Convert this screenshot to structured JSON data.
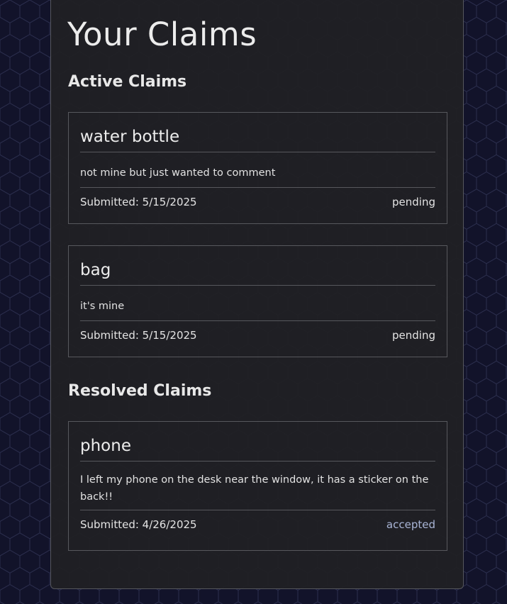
{
  "page": {
    "title": "Your Claims"
  },
  "sections": {
    "active": {
      "heading": "Active Claims",
      "claims": [
        {
          "item": "water bottle",
          "description": "not mine but just wanted to comment",
          "submitted": "Submitted: 5/15/2025",
          "status": "pending"
        },
        {
          "item": "bag",
          "description": "it's mine",
          "submitted": "Submitted: 5/15/2025",
          "status": "pending"
        }
      ]
    },
    "resolved": {
      "heading": "Resolved Claims",
      "claims": [
        {
          "item": "phone",
          "description": "I left my phone on the desk near the window, it has a sticker on the back!!",
          "submitted": "Submitted: 4/26/2025",
          "status": "accepted"
        }
      ]
    }
  },
  "colors": {
    "background": "#12132a",
    "panel": "#202024",
    "border": "#57585d",
    "text": "#e6e6e6",
    "status_accepted": "#a9b5d6"
  }
}
